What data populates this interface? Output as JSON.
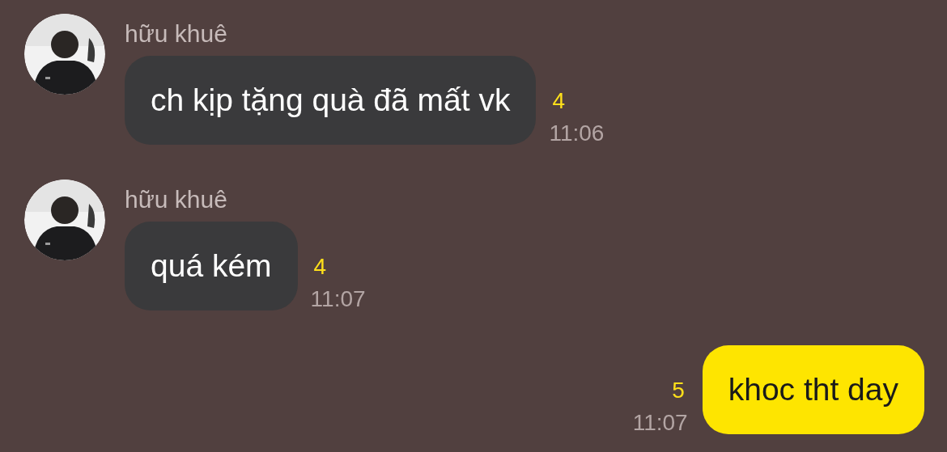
{
  "messages": [
    {
      "kind": "received",
      "sender": "hữu khuê",
      "text": "ch kịp tặng quà đã mất vk",
      "unread": "4",
      "time": "11:06"
    },
    {
      "kind": "received",
      "sender": "hữu khuê",
      "text": "quá kém",
      "unread": "4",
      "time": "11:07"
    },
    {
      "kind": "sent",
      "text": "khoc tht day",
      "unread": "5",
      "time": "11:07"
    }
  ]
}
